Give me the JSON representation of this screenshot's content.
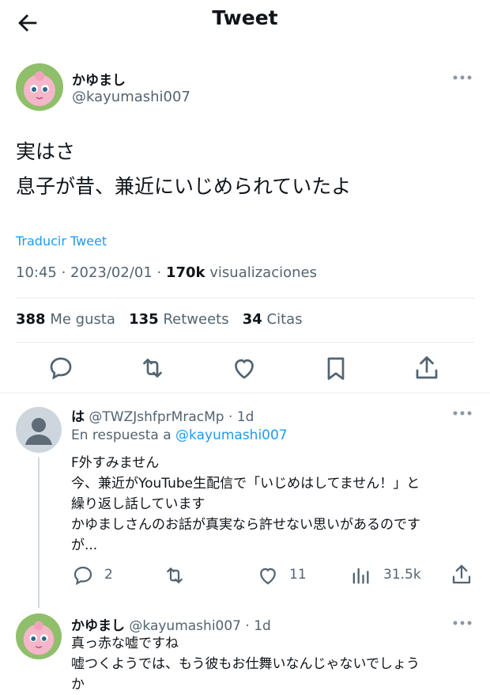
{
  "header": {
    "title": "Tweet"
  },
  "tweet": {
    "author_name": "かゆまし",
    "author_handle": "@kayumashi007",
    "text_line1": "実はさ",
    "text_line2": "息子が昔、兼近にいじめられていたよ",
    "translate_label": "Traducir Tweet",
    "time": "10:45",
    "date": "2023/02/01",
    "views_count": "170k",
    "views_label": "visualizaciones",
    "likes_count": "388",
    "likes_label": "Me gusta",
    "retweets_count": "135",
    "retweets_label": "Retweets",
    "quotes_count": "34",
    "quotes_label": "Citas"
  },
  "replies": [
    {
      "author_name": "は",
      "author_handle": "@TWZJshfprMracMp",
      "time": "1d",
      "reply_to_prefix": "En respuesta a",
      "reply_to_handle": "@kayumashi007",
      "lines": [
        "F外すみません",
        "今、兼近がYouTube生配信で「いじめはしてません！」と",
        "繰り返し話しています",
        "かゆましさんのお話が真実なら許せない思いがあるのです",
        "が..."
      ],
      "reply_count": "2",
      "retweet_count": "",
      "like_count": "11",
      "views_count": "31.5k"
    },
    {
      "author_name": "かゆまし",
      "author_handle": "@kayumashi007",
      "time": "1d",
      "lines": [
        "真っ赤な嘘ですね",
        "嘘つくようでは、もう彼もお仕舞いなんじゃないでしょう",
        "か"
      ]
    }
  ],
  "colors": {
    "accent": "#1d9bf0",
    "muted": "#536471",
    "divider": "#e6ecf0",
    "thread_line": "#cfd9de"
  },
  "icons": [
    "back-arrow-icon",
    "more-icon",
    "reply-icon",
    "retweet-icon",
    "like-icon",
    "bookmark-icon",
    "share-icon",
    "views-icon",
    "default-avatar-icon"
  ]
}
